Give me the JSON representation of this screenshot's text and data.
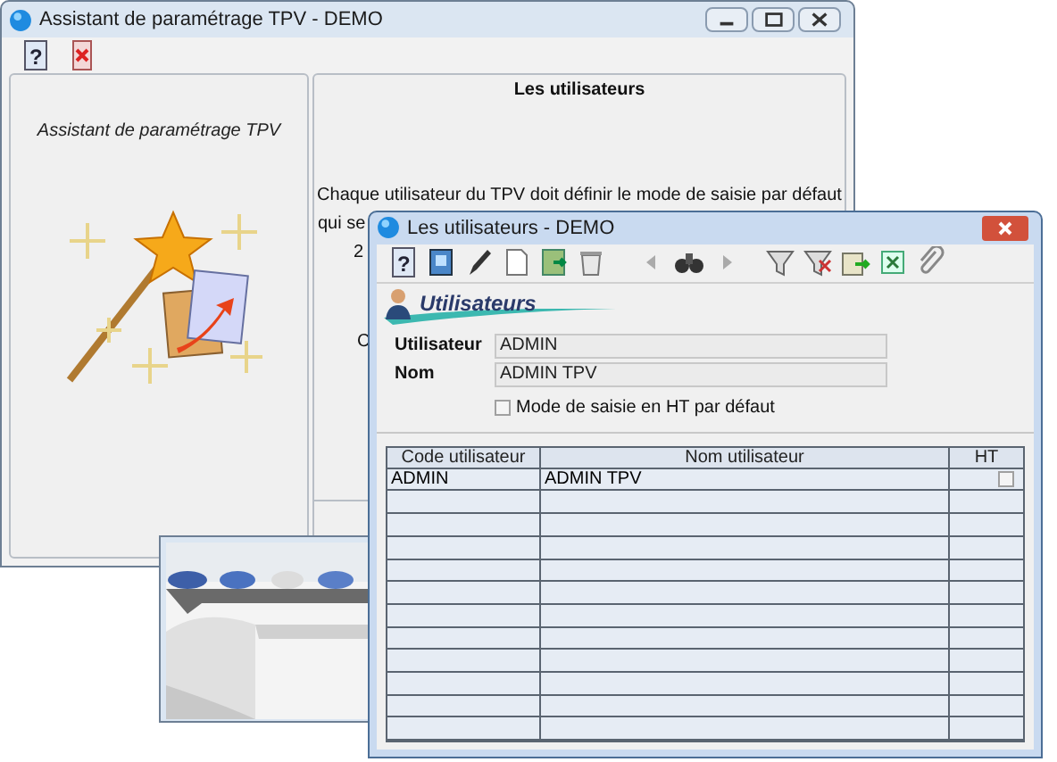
{
  "back_window": {
    "title": "Assistant de paramétrage TPV - DEMO",
    "help_glyph": "?",
    "side_caption": "Assistant de paramétrage TPV",
    "panel_title": "Les utilisateurs",
    "paragraph": [
      "Chaque utilisateur du TPV doit définir le mode de saisie par défaut",
      "qui se",
      "2",
      "C"
    ]
  },
  "front_window": {
    "title": "Les utilisateurs - DEMO",
    "help_glyph": "?",
    "section_title": "Utilisateurs",
    "fields": [
      {
        "label": "Utilisateur",
        "value": "ADMIN"
      },
      {
        "label": "Nom",
        "value": "ADMIN TPV"
      }
    ],
    "option": {
      "label": "Mode de saisie en HT par défaut",
      "checked": false
    },
    "table": {
      "columns": [
        "Code utilisateur",
        "Nom utilisateur",
        "HT"
      ],
      "rows": [
        {
          "code": "ADMIN",
          "name": "ADMIN TPV",
          "ht": false
        }
      ]
    }
  }
}
